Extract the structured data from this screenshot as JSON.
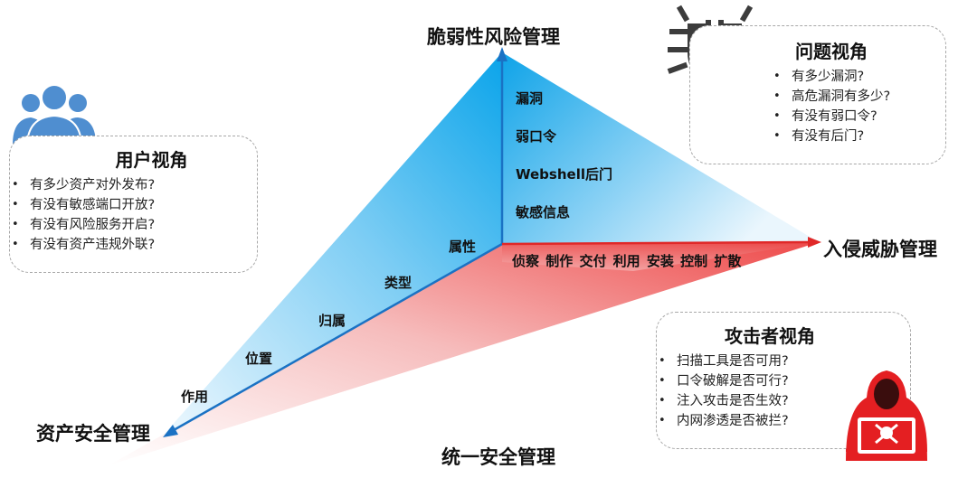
{
  "axes": {
    "top": "脆弱性风险管理",
    "right": "入侵威胁管理",
    "left": "资产安全管理",
    "bottom": "统一安全管理"
  },
  "asset_attributes": [
    "作用",
    "位置",
    "归属",
    "类型",
    "属性"
  ],
  "vulnerabilities": [
    "漏洞",
    "弱口令",
    "Webshell后门",
    "敏感信息"
  ],
  "kill_chain": "侦察 制作 交付 利用 安装 控制 扩散",
  "views": {
    "user": {
      "title": "用户视角",
      "items": [
        "有多少资产对外发布?",
        "有没有敏感端口开放?",
        "有没有风险服务开启?",
        "有没有资产违规外联?"
      ]
    },
    "problem": {
      "title": "问题视角",
      "items": [
        "有多少漏洞?",
        "高危漏洞有多少?",
        "有没有弱口令?",
        "有没有后门?"
      ]
    },
    "attacker": {
      "title": "攻击者视角",
      "items": [
        "扫描工具是否可用?",
        "口令破解是否可行?",
        "注入攻击是否生效?",
        "内网渗透是否被拦?"
      ]
    }
  },
  "colors": {
    "blue_dark": "#0a7fd6",
    "blue_light": "#d9eefb",
    "red": "#e83a3a",
    "red_light": "#fbe3e3",
    "icon_blue": "#4f8ed0",
    "icon_gray": "#3c3c3c",
    "hacker_red": "#e41f22"
  }
}
